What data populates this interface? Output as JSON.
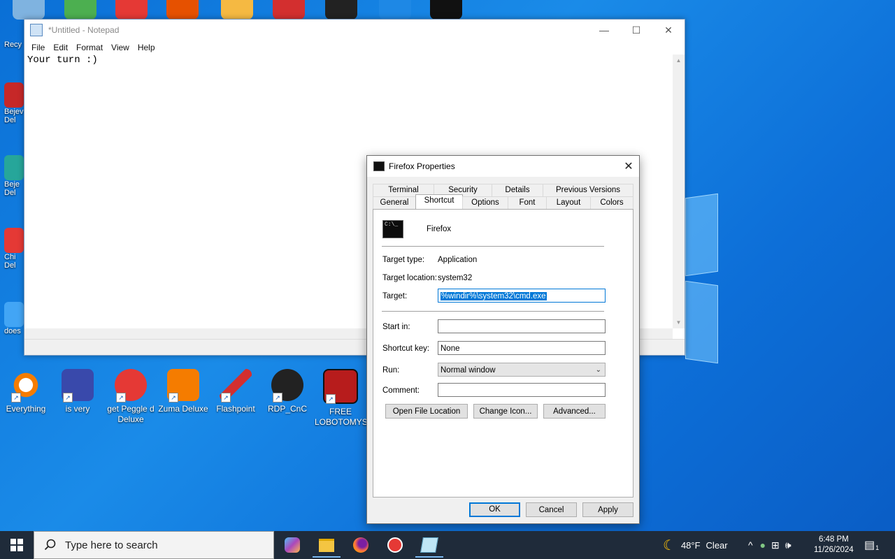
{
  "notepad": {
    "title": "*Untitled - Notepad",
    "menu": [
      "File",
      "Edit",
      "Format",
      "View",
      "Help"
    ],
    "content": "Your turn :)"
  },
  "dialog": {
    "title": "Firefox Properties",
    "tabs_row1": [
      "Terminal",
      "Security",
      "Details",
      "Previous Versions"
    ],
    "tabs_row2": [
      "General",
      "Shortcut",
      "Options",
      "Font",
      "Layout",
      "Colors"
    ],
    "active_tab": "Shortcut",
    "name": "Firefox",
    "target_type_label": "Target type:",
    "target_type": "Application",
    "target_location_label": "Target location:",
    "target_location": "system32",
    "target_label": "Target:",
    "target_value": "%windir%\\system32\\cmd.exe",
    "start_in_label": "Start in:",
    "start_in_value": "",
    "shortcut_key_label": "Shortcut key:",
    "shortcut_key_value": "None",
    "run_label": "Run:",
    "run_value": "Normal window",
    "comment_label": "Comment:",
    "comment_value": "",
    "btn_open_location": "Open File Location",
    "btn_change_icon": "Change Icon...",
    "btn_advanced": "Advanced...",
    "btn_ok": "OK",
    "btn_cancel": "Cancel",
    "btn_apply": "Apply"
  },
  "desktop": {
    "left_icons": [
      "Recy",
      "Bejev Del",
      "Beje Del",
      "Chi Del",
      "does"
    ],
    "bottom_icons": [
      "Everything",
      "is very",
      "get Peggle d Deluxe",
      "Zuma Deluxe",
      "Flashpoint",
      "RDP_CnC",
      "FREE LOBOTOMYS"
    ]
  },
  "taskbar": {
    "search_placeholder": "Type here to search",
    "weather": "48°F",
    "weather_desc": "Clear",
    "time": "6:48 PM",
    "date": "11/26/2024",
    "notification_count": "1"
  },
  "colors": {
    "desktop_blue": "#0a6fd6",
    "selection_blue": "#0078d7",
    "taskbar": "#1f2b3a"
  }
}
